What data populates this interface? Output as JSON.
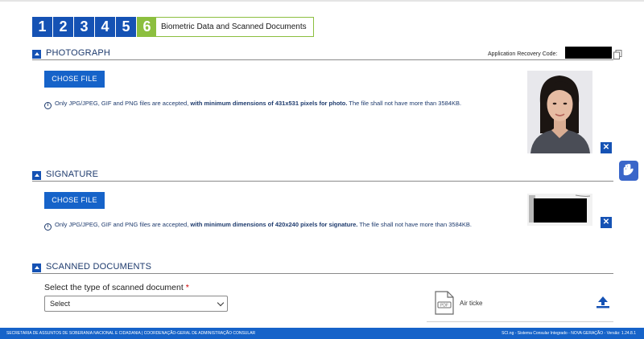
{
  "wizard": {
    "steps": [
      "1",
      "2",
      "3",
      "4",
      "5",
      "6"
    ],
    "current_step_title": "Biometric Data and Scanned Documents"
  },
  "photograph": {
    "section_title": "PHOTOGRAPH",
    "recovery_label": "Application Recovery Code:",
    "button_label": "CHOSE FILE",
    "info_text_1": "Only JPG/JPEG, GIF and PNG files are accepted, ",
    "info_text_bold": "with minimum dimensions of 431x531 pixels for photo.",
    "info_text_2": " The file shall not have more than 3584KB.",
    "remove_label": "✕"
  },
  "signature": {
    "section_title": "SIGNATURE",
    "button_label": "CHOSE FILE",
    "info_text_1": "Only JPG/JPEG, GIF and PNG files are accepted, ",
    "info_text_bold": "with minimum dimensions of 420x240 pixels for signature.",
    "info_text_2": " The file shall not have more than 3584KB.",
    "remove_label": "✕"
  },
  "scanned_documents": {
    "section_title": "SCANNED DOCUMENTS",
    "select_label": "Select the type of scanned document",
    "required_mark": "*",
    "select_value": "Select",
    "file_label": "Air ticke"
  },
  "footer": {
    "left_text": "SECRETARIA DE ASSUNTOS DE SOBERANIA NACIONAL E CIDADANIA | COORDENAÇÃO-GERAL DE ADMINISTRAÇÃO CONSULAR",
    "right_text": "SCI.ng - Sistema Consular Integrado - NOVA GERAÇÃO - Versão: 1.24.8.1"
  },
  "colors": {
    "primary": "#1552b4",
    "active_step": "#8cbf3f",
    "footer": "#1663c9"
  }
}
